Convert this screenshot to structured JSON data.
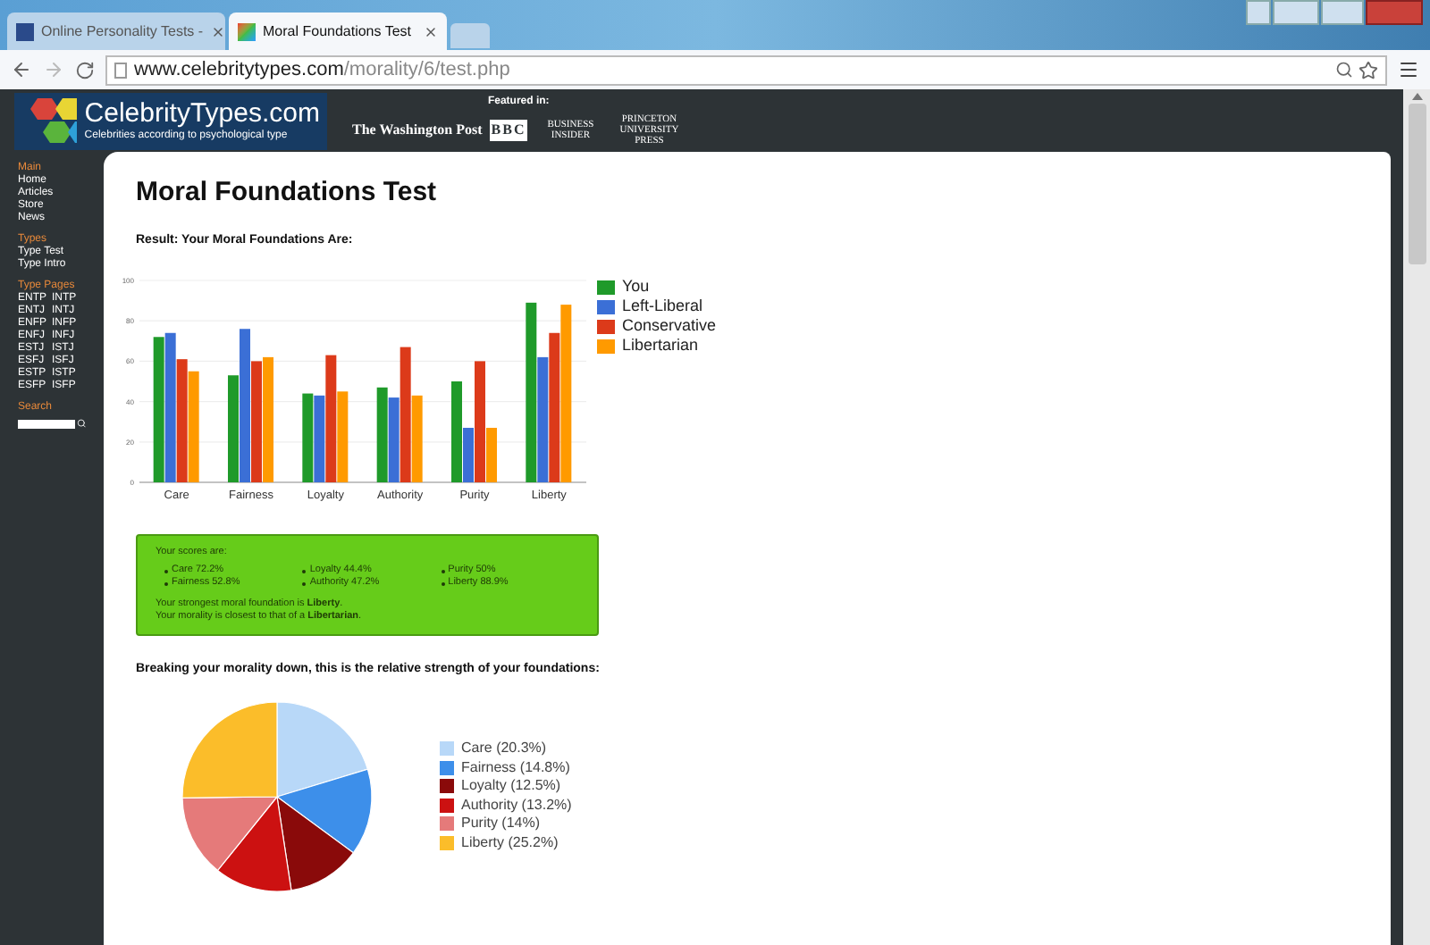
{
  "browser": {
    "tabs": [
      {
        "title": "Online Personality Tests -",
        "selected": false
      },
      {
        "title": "Moral Foundations Test",
        "selected": true
      }
    ],
    "address": {
      "domain": "www.celebritytypes.com",
      "path": "/morality/6/test.php"
    }
  },
  "site_header": {
    "logo": {
      "name": "CelebrityTypes.com",
      "tagline": "Celebrities according to psychological type"
    },
    "featured_label": "Featured in:",
    "outlets": [
      "The Washington Post",
      "BBC",
      "BUSINESS INSIDER",
      "PRINCETON UNIVERSITY PRESS"
    ]
  },
  "sidebar": {
    "sections": [
      {
        "heading": "Main",
        "items": [
          "Home",
          "Articles",
          "Store",
          "News"
        ]
      },
      {
        "heading": "Types",
        "items": [
          "Type Test",
          "Type Intro"
        ]
      },
      {
        "heading": "Type Pages",
        "items": [
          "ENTP",
          "INTP",
          "ENTJ",
          "INTJ",
          "ENFP",
          "INFP",
          "ENFJ",
          "INFJ",
          "ESTJ",
          "ISTJ",
          "ESFJ",
          "ISFJ",
          "ESTP",
          "ISTP",
          "ESFP",
          "ISFP"
        ]
      }
    ],
    "search_heading": "Search"
  },
  "content": {
    "title": "Moral Foundations Test",
    "result_heading": "Result: Your Moral Foundations Are:",
    "chart_data": {
      "type": "bar",
      "grid": true,
      "legend": "right",
      "categories": [
        "Care",
        "Fairness",
        "Loyalty",
        "Authority",
        "Purity",
        "Liberty"
      ],
      "ylim": [
        0,
        100
      ],
      "yticks": [
        0,
        20,
        40,
        60,
        80,
        100
      ],
      "series": [
        {
          "name": "You",
          "color": "#1f9a2a",
          "values": [
            72,
            53,
            44,
            47,
            50,
            89
          ]
        },
        {
          "name": "Left-Liberal",
          "color": "#3b6fd6",
          "values": [
            74,
            76,
            43,
            42,
            27,
            62
          ]
        },
        {
          "name": "Conservative",
          "color": "#dc3a1a",
          "values": [
            61,
            60,
            63,
            67,
            60,
            74
          ]
        },
        {
          "name": "Libertarian",
          "color": "#ff9a00",
          "values": [
            55,
            62,
            45,
            43,
            27,
            88
          ]
        }
      ]
    },
    "scores": {
      "heading": "Your scores are:",
      "items": [
        "Care 72.2%",
        "Fairness 52.8%",
        "Loyalty 44.4%",
        "Authority 47.2%",
        "Purity 50%",
        "Liberty 88.9%"
      ],
      "summary": [
        "Your strongest moral foundation is **Liberty**.",
        "Your morality is closest to that of a **Libertarian**."
      ]
    },
    "breakdown": {
      "heading": "Breaking your morality down, this is the relative strength of your foundations:",
      "chart_data": {
        "type": "pie",
        "legend": "right",
        "categories": [
          "Care (20.3%)",
          "Fairness (14.8%)",
          "Loyalty (12.5%)",
          "Authority (13.2%)",
          "Purity (14%)",
          "Liberty (25.2%)"
        ],
        "values": [
          20.3,
          14.8,
          12.5,
          13.2,
          14,
          25.2
        ],
        "colors": [
          "#b8d8f8",
          "#3d8fea",
          "#8a0a0a",
          "#cc1111",
          "#e57a7a",
          "#fbbd2a"
        ]
      }
    }
  }
}
